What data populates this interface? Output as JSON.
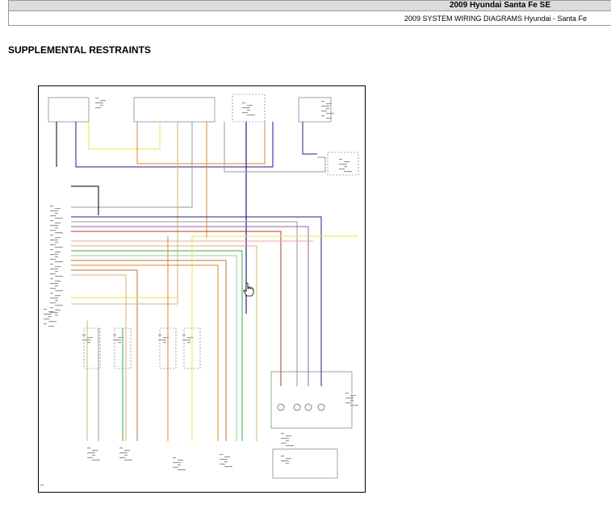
{
  "header": {
    "title": "2009 Hyundai Santa Fe SE",
    "subtitle": "2009 SYSTEM WIRING DIAGRAMS Hyundai - Santa Fe"
  },
  "section": {
    "title": "SUPPLEMENTAL RESTRAINTS"
  },
  "diagram": {
    "description_icon": "wiring-diagram",
    "wire_colors": {
      "black": "#000000",
      "blue": "#1a1a9c",
      "yellow": "#f2e24a",
      "orange": "#e8822a",
      "gray": "#9a9a9a",
      "red": "#c43030",
      "green": "#3aa84a",
      "light_green": "#8fd08a",
      "brown": "#b8763a",
      "tan": "#d8b07a",
      "violet": "#9a5ca8",
      "pink": "#e8a4b4",
      "navy": "#20208a"
    }
  },
  "cursor": {
    "icon": "hand-pointer-icon"
  }
}
